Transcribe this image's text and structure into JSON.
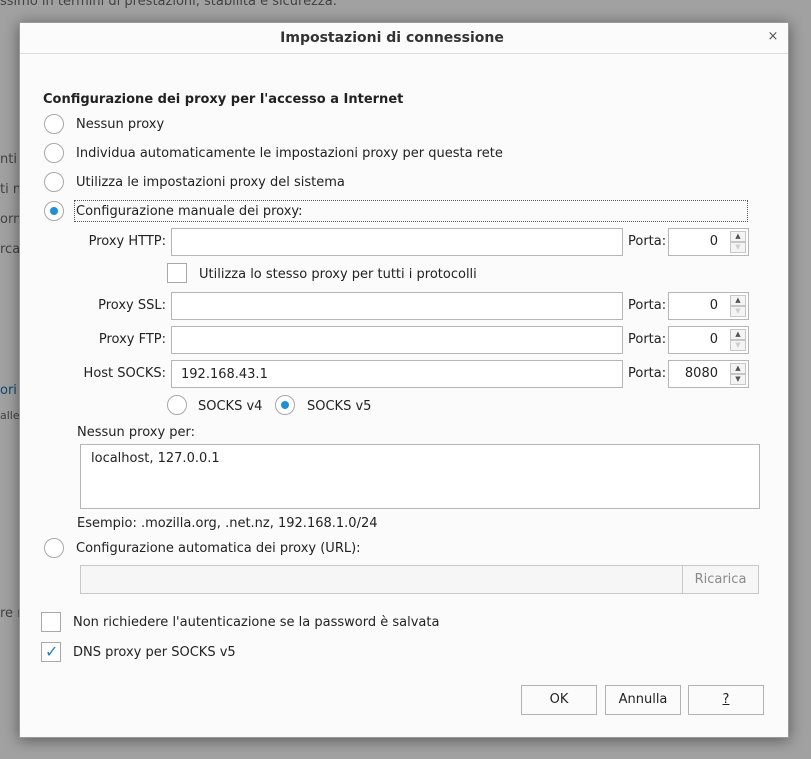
{
  "background": {
    "fragments": [
      "ssimo in termini di prestazioni, stabilità e sicurezza.",
      "nti",
      "ti n",
      "orn",
      "rca",
      "ori",
      "alle",
      "re n"
    ]
  },
  "dialog": {
    "title": "Impostazioni di connessione",
    "close_glyph": "×",
    "section_title": "Configurazione dei proxy per l'accesso a Internet",
    "options": {
      "no_proxy": "Nessun proxy",
      "auto_detect": "Individua automaticamente le impostazioni proxy per questa rete",
      "system": "Utilizza le impostazioni proxy del sistema",
      "manual": "Configurazione manuale dei proxy:",
      "auto_url": "Configurazione automatica dei proxy (URL):"
    },
    "selected_option": "manual",
    "http": {
      "label": "Proxy HTTP:",
      "value": "",
      "port_label": "Porta:",
      "port": "0"
    },
    "same_proxy_label": "Utilizza lo stesso proxy per tutti i protocolli",
    "same_proxy_checked": false,
    "ssl": {
      "label": "Proxy SSL:",
      "value": "",
      "port_label": "Porta:",
      "port": "0"
    },
    "ftp": {
      "label": "Proxy FTP:",
      "value": "",
      "port_label": "Porta:",
      "port": "0"
    },
    "socks": {
      "label": "Host SOCKS:",
      "value": "192.168.43.1",
      "port_label": "Porta:",
      "port": "8080"
    },
    "socks_v4": "SOCKS v4",
    "socks_v5": "SOCKS v5",
    "socks_selected": "v5",
    "no_proxy_for": {
      "label": "Nessun proxy per:",
      "value": "localhost, 127.0.0.1"
    },
    "example": "Esempio: .mozilla.org, .net.nz, 192.168.1.0/24",
    "auto_url_value": "",
    "reload_label": "Ricarica",
    "no_auth_label": "Non richiedere l'autenticazione se la password è salvata",
    "no_auth_checked": false,
    "dns_label": "DNS proxy per SOCKS v5",
    "dns_checked": true,
    "check_glyph": "✓",
    "spin_up": "▲",
    "spin_down": "▼",
    "buttons": {
      "ok": "OK",
      "cancel": "Annulla",
      "help": "?"
    }
  },
  "colors": {
    "accent": "#1f8fd6",
    "check": "#1f7fc4"
  }
}
